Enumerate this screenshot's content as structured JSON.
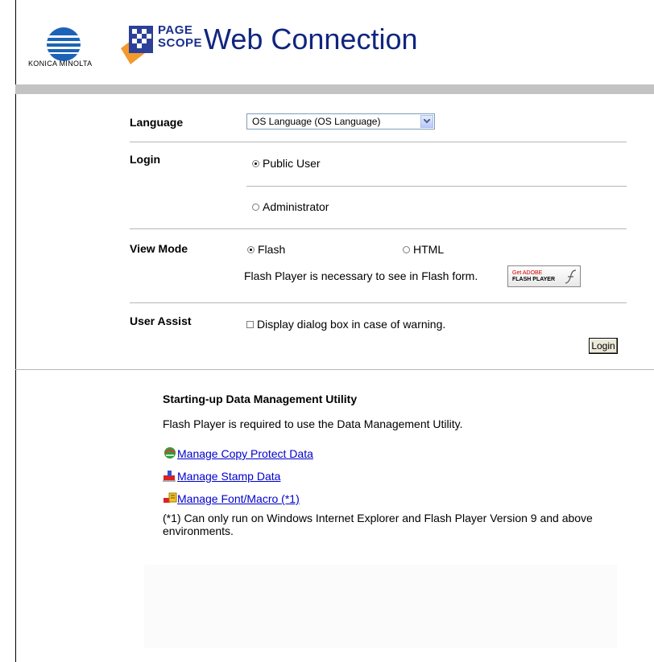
{
  "header": {
    "brand": "KONICA MINOLTA",
    "pagescope_line1": "PAGE",
    "pagescope_line2": "SCOPE",
    "app_title": "Web Connection"
  },
  "form": {
    "language": {
      "label": "Language",
      "selected": "OS Language (OS Language)"
    },
    "login": {
      "label": "Login",
      "options": [
        "Public User",
        "Administrator"
      ],
      "selected": "Public User"
    },
    "view_mode": {
      "label": "View Mode",
      "options": [
        "Flash",
        "HTML"
      ],
      "selected": "Flash",
      "note": "Flash Player is necessary to see in Flash form.",
      "badge_line1": "Get ADOBE",
      "badge_line2": "FLASH PLAYER"
    },
    "user_assist": {
      "label": "User Assist",
      "checkbox_label": "Display dialog box in case of warning.",
      "checked": false
    },
    "login_button": "Login"
  },
  "utility": {
    "title": "Starting-up Data Management Utility",
    "description": "Flash Player is required to use the Data Management Utility.",
    "links": [
      {
        "label": "Manage Copy Protect Data",
        "icon": "copy-protect-icon"
      },
      {
        "label": "Manage Stamp Data",
        "icon": "stamp-icon"
      },
      {
        "label": "Manage Font/Macro (*1)",
        "icon": "font-macro-icon"
      }
    ],
    "footnote": "(*1) Can only run on Windows Internet Explorer and Flash Player Version 9 and above environments."
  },
  "colors": {
    "title_blue": "#10257f",
    "link_blue": "#0000cc",
    "bar_grey": "#c3c3c3"
  }
}
